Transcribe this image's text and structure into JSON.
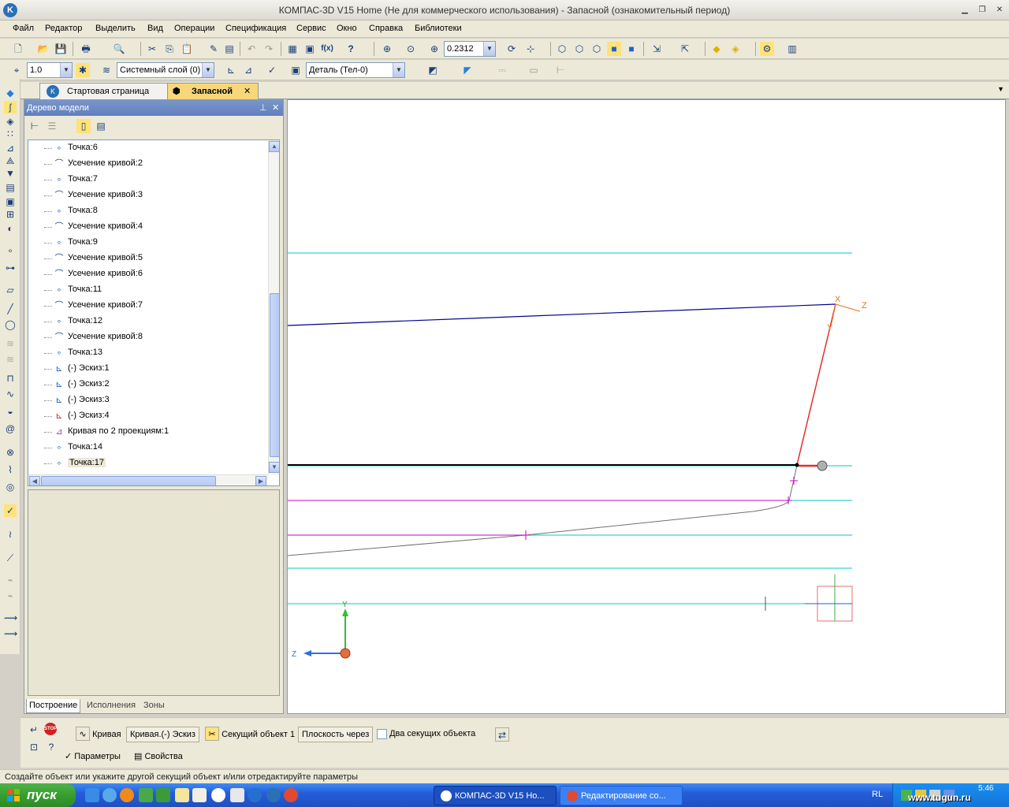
{
  "window": {
    "title": "КОМПАС-3D V15 Home (Не для коммерческого использования) - Запасной (ознакомительный период)"
  },
  "menu": [
    "Файл",
    "Редактор",
    "Выделить",
    "Вид",
    "Операции",
    "Спецификация",
    "Сервис",
    "Окно",
    "Справка",
    "Библиотеки"
  ],
  "toolbar": {
    "zoom_value": "0.2312",
    "scale_value": "1.0",
    "layer_value": "Системный слой (0)",
    "detail_value": "Деталь (Тел-0)"
  },
  "tabs": [
    {
      "label": "Стартовая страница"
    },
    {
      "label": "Запасной"
    }
  ],
  "tree_panel": {
    "title": "Дерево модели",
    "items": [
      {
        "label": "Точка:6",
        "icon": "point-icon"
      },
      {
        "label": "Усечение кривой:2",
        "icon": "trim-curve-icon"
      },
      {
        "label": "Точка:7",
        "icon": "point-icon"
      },
      {
        "label": "Усечение кривой:3",
        "icon": "trim-curve-icon"
      },
      {
        "label": "Точка:8",
        "icon": "point-icon"
      },
      {
        "label": "Усечение кривой:4",
        "icon": "trim-curve-icon"
      },
      {
        "label": "Точка:9",
        "icon": "point-icon"
      },
      {
        "label": "Усечение кривой:5",
        "icon": "trim-curve-icon"
      },
      {
        "label": "Усечение кривой:6",
        "icon": "trim-curve-icon"
      },
      {
        "label": "Точка:11",
        "icon": "point-icon"
      },
      {
        "label": "Усечение кривой:7",
        "icon": "trim-curve-icon"
      },
      {
        "label": "Точка:12",
        "icon": "point-icon"
      },
      {
        "label": "Усечение кривой:8",
        "icon": "trim-curve-icon"
      },
      {
        "label": "Точка:13",
        "icon": "point-icon"
      },
      {
        "label": "(-) Эскиз:1",
        "icon": "sketch-icon"
      },
      {
        "label": "(-) Эскиз:2",
        "icon": "sketch-icon"
      },
      {
        "label": "(-) Эскиз:3",
        "icon": "sketch-icon"
      },
      {
        "label": "(-) Эскиз:4",
        "icon": "sketch-error-icon"
      },
      {
        "label": "Кривая по 2 проекциям:1",
        "icon": "curve-projections-icon"
      },
      {
        "label": "Точка:14",
        "icon": "point-icon"
      },
      {
        "label": "Точка:17",
        "icon": "point-icon",
        "selected": true
      }
    ],
    "bottom_tabs": [
      "Построение",
      "Исполнения",
      "Зоны"
    ]
  },
  "canvas": {
    "axis_labels": {
      "x": "X",
      "y": "Y",
      "z": "Z"
    },
    "origin_labels": {
      "y": "Y",
      "z": "Z"
    }
  },
  "property_bar": {
    "curve_label": "Кривая",
    "curve_value": "Кривая.(-) Эскиз",
    "cutter_label": "Секущий объект 1",
    "plane_button": "Плоскость через",
    "two_cutters_label": "Два секущих объекта",
    "tab_params": "Параметры",
    "tab_props": "Свойства"
  },
  "status": {
    "text": "Создайте объект или укажите другой секущий объект и/или отредактируйте параметры"
  },
  "taskbar": {
    "start_label": "пуск",
    "tasks": [
      "КОМПАС-3D V15 Ho...",
      "Редактирование со..."
    ],
    "lang": "RL",
    "clock": "5:46",
    "watermark": "www.tugun.ru"
  },
  "colors": {
    "accent": "#316ac5",
    "cyan_line": "#00c8c8",
    "blue_line": "#00008b",
    "magenta_line": "#c800c8",
    "red_line": "#e03030",
    "orange_axis": "#e87020"
  }
}
